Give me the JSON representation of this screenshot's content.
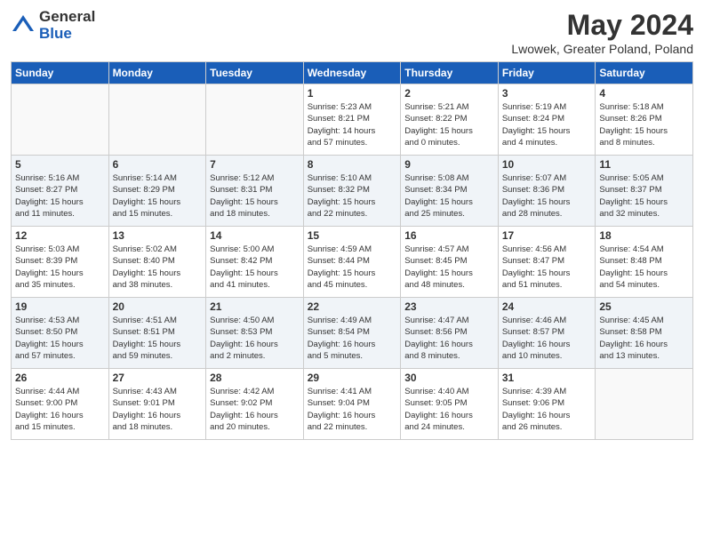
{
  "logo": {
    "general": "General",
    "blue": "Blue"
  },
  "title": "May 2024",
  "subtitle": "Lwowek, Greater Poland, Poland",
  "days_of_week": [
    "Sunday",
    "Monday",
    "Tuesday",
    "Wednesday",
    "Thursday",
    "Friday",
    "Saturday"
  ],
  "weeks": [
    [
      {
        "day": "",
        "info": ""
      },
      {
        "day": "",
        "info": ""
      },
      {
        "day": "",
        "info": ""
      },
      {
        "day": "1",
        "info": "Sunrise: 5:23 AM\nSunset: 8:21 PM\nDaylight: 14 hours\nand 57 minutes."
      },
      {
        "day": "2",
        "info": "Sunrise: 5:21 AM\nSunset: 8:22 PM\nDaylight: 15 hours\nand 0 minutes."
      },
      {
        "day": "3",
        "info": "Sunrise: 5:19 AM\nSunset: 8:24 PM\nDaylight: 15 hours\nand 4 minutes."
      },
      {
        "day": "4",
        "info": "Sunrise: 5:18 AM\nSunset: 8:26 PM\nDaylight: 15 hours\nand 8 minutes."
      }
    ],
    [
      {
        "day": "5",
        "info": "Sunrise: 5:16 AM\nSunset: 8:27 PM\nDaylight: 15 hours\nand 11 minutes."
      },
      {
        "day": "6",
        "info": "Sunrise: 5:14 AM\nSunset: 8:29 PM\nDaylight: 15 hours\nand 15 minutes."
      },
      {
        "day": "7",
        "info": "Sunrise: 5:12 AM\nSunset: 8:31 PM\nDaylight: 15 hours\nand 18 minutes."
      },
      {
        "day": "8",
        "info": "Sunrise: 5:10 AM\nSunset: 8:32 PM\nDaylight: 15 hours\nand 22 minutes."
      },
      {
        "day": "9",
        "info": "Sunrise: 5:08 AM\nSunset: 8:34 PM\nDaylight: 15 hours\nand 25 minutes."
      },
      {
        "day": "10",
        "info": "Sunrise: 5:07 AM\nSunset: 8:36 PM\nDaylight: 15 hours\nand 28 minutes."
      },
      {
        "day": "11",
        "info": "Sunrise: 5:05 AM\nSunset: 8:37 PM\nDaylight: 15 hours\nand 32 minutes."
      }
    ],
    [
      {
        "day": "12",
        "info": "Sunrise: 5:03 AM\nSunset: 8:39 PM\nDaylight: 15 hours\nand 35 minutes."
      },
      {
        "day": "13",
        "info": "Sunrise: 5:02 AM\nSunset: 8:40 PM\nDaylight: 15 hours\nand 38 minutes."
      },
      {
        "day": "14",
        "info": "Sunrise: 5:00 AM\nSunset: 8:42 PM\nDaylight: 15 hours\nand 41 minutes."
      },
      {
        "day": "15",
        "info": "Sunrise: 4:59 AM\nSunset: 8:44 PM\nDaylight: 15 hours\nand 45 minutes."
      },
      {
        "day": "16",
        "info": "Sunrise: 4:57 AM\nSunset: 8:45 PM\nDaylight: 15 hours\nand 48 minutes."
      },
      {
        "day": "17",
        "info": "Sunrise: 4:56 AM\nSunset: 8:47 PM\nDaylight: 15 hours\nand 51 minutes."
      },
      {
        "day": "18",
        "info": "Sunrise: 4:54 AM\nSunset: 8:48 PM\nDaylight: 15 hours\nand 54 minutes."
      }
    ],
    [
      {
        "day": "19",
        "info": "Sunrise: 4:53 AM\nSunset: 8:50 PM\nDaylight: 15 hours\nand 57 minutes."
      },
      {
        "day": "20",
        "info": "Sunrise: 4:51 AM\nSunset: 8:51 PM\nDaylight: 15 hours\nand 59 minutes."
      },
      {
        "day": "21",
        "info": "Sunrise: 4:50 AM\nSunset: 8:53 PM\nDaylight: 16 hours\nand 2 minutes."
      },
      {
        "day": "22",
        "info": "Sunrise: 4:49 AM\nSunset: 8:54 PM\nDaylight: 16 hours\nand 5 minutes."
      },
      {
        "day": "23",
        "info": "Sunrise: 4:47 AM\nSunset: 8:56 PM\nDaylight: 16 hours\nand 8 minutes."
      },
      {
        "day": "24",
        "info": "Sunrise: 4:46 AM\nSunset: 8:57 PM\nDaylight: 16 hours\nand 10 minutes."
      },
      {
        "day": "25",
        "info": "Sunrise: 4:45 AM\nSunset: 8:58 PM\nDaylight: 16 hours\nand 13 minutes."
      }
    ],
    [
      {
        "day": "26",
        "info": "Sunrise: 4:44 AM\nSunset: 9:00 PM\nDaylight: 16 hours\nand 15 minutes."
      },
      {
        "day": "27",
        "info": "Sunrise: 4:43 AM\nSunset: 9:01 PM\nDaylight: 16 hours\nand 18 minutes."
      },
      {
        "day": "28",
        "info": "Sunrise: 4:42 AM\nSunset: 9:02 PM\nDaylight: 16 hours\nand 20 minutes."
      },
      {
        "day": "29",
        "info": "Sunrise: 4:41 AM\nSunset: 9:04 PM\nDaylight: 16 hours\nand 22 minutes."
      },
      {
        "day": "30",
        "info": "Sunrise: 4:40 AM\nSunset: 9:05 PM\nDaylight: 16 hours\nand 24 minutes."
      },
      {
        "day": "31",
        "info": "Sunrise: 4:39 AM\nSunset: 9:06 PM\nDaylight: 16 hours\nand 26 minutes."
      },
      {
        "day": "",
        "info": ""
      }
    ]
  ]
}
